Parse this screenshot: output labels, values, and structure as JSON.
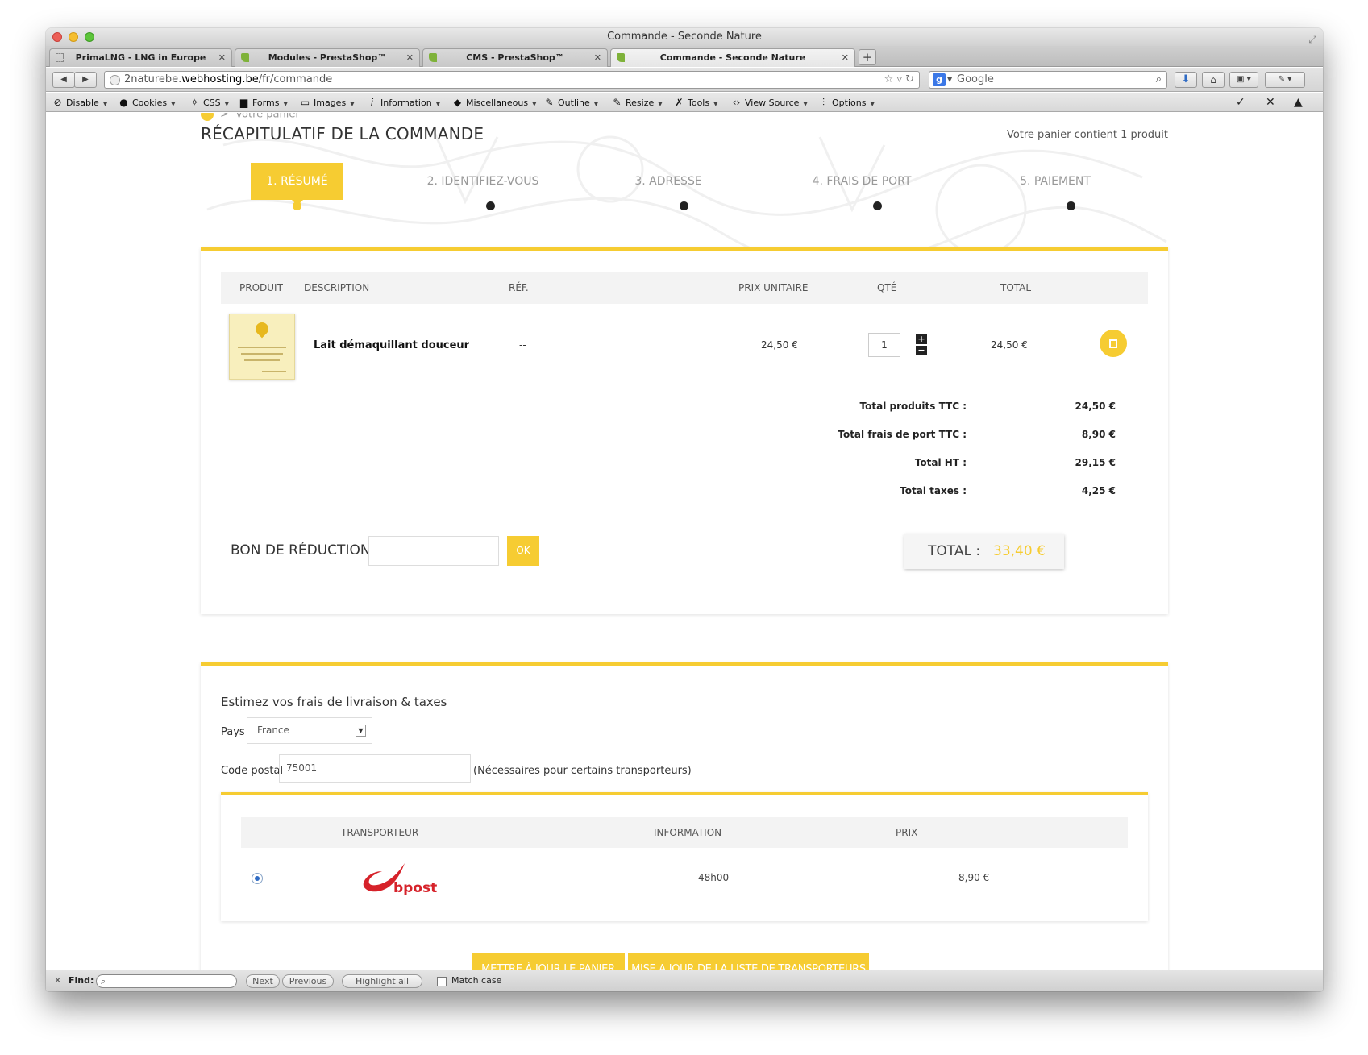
{
  "window": {
    "title": "Commande - Seconde Nature"
  },
  "tabs": [
    {
      "label": "PrimaLNG - LNG in Europe",
      "active": false
    },
    {
      "label": "Modules - PrestaShop™",
      "active": false
    },
    {
      "label": "CMS - PrestaShop™",
      "active": false
    },
    {
      "label": "Commande - Seconde Nature",
      "active": true
    }
  ],
  "nav": {
    "url_prefix": "2naturebe.",
    "url_domain": "webhosting.be",
    "url_path": "/fr/commande",
    "search_placeholder": "Google"
  },
  "devbar": {
    "items": [
      "Disable",
      "Cookies",
      "CSS",
      "Forms",
      "Images",
      "Information",
      "Miscellaneous",
      "Outline",
      "Resize",
      "Tools",
      "View Source",
      "Options"
    ]
  },
  "page": {
    "breadcrumb": "Votre panier",
    "title": "RÉCAPITULATIF DE LA COMMANDE",
    "cart_count": "Votre panier contient 1 produit"
  },
  "steps": [
    {
      "label": "1. RÉSUMÉ",
      "active": true
    },
    {
      "label": "2. IDENTIFIEZ-VOUS",
      "active": false
    },
    {
      "label": "3. ADRESSE",
      "active": false
    },
    {
      "label": "4. FRAIS DE PORT",
      "active": false
    },
    {
      "label": "5. PAIEMENT",
      "active": false
    }
  ],
  "cart": {
    "headers": {
      "product": "PRODUIT",
      "description": "DESCRIPTION",
      "ref": "RÉF.",
      "unit_price": "PRIX UNITAIRE",
      "qty": "QTÉ",
      "total": "TOTAL"
    },
    "item": {
      "name": "Lait démaquillant douceur",
      "ref": "--",
      "unit_price": "24,50 €",
      "qty": "1",
      "total": "24,50 €"
    },
    "totals": [
      {
        "label": "Total produits TTC :",
        "value": "24,50 €"
      },
      {
        "label": "Total frais de port TTC :",
        "value": "8,90 €"
      },
      {
        "label": "Total HT :",
        "value": "29,15 €"
      },
      {
        "label": "Total taxes :",
        "value": "4,25 €"
      }
    ],
    "voucher_label": "BON DE RÉDUCTION",
    "voucher_button": "OK",
    "grand_total_label": "TOTAL :",
    "grand_total_value": "33,40 €"
  },
  "shipping": {
    "title": "Estimez vos frais de livraison & taxes",
    "country_label": "Pays",
    "country_value": "France",
    "postcode_label": "Code postal",
    "postcode_value": "75001",
    "postcode_note": "(Nécessaires pour certains transporteurs)",
    "headers": {
      "carrier": "TRANSPORTEUR",
      "info": "INFORMATION",
      "price": "PRIX"
    },
    "carrier": {
      "logo_text": "bpost",
      "info": "48h00",
      "price": "8,90 €"
    },
    "update_cart_button": "METTRE À JOUR LE PANIER",
    "update_carriers_button": "MISE A JOUR DE LA LISTE DE TRANSPORTEURS"
  },
  "findbar": {
    "label": "Find:",
    "next": "Next",
    "previous": "Previous",
    "highlight_all": "Highlight all",
    "match_case": "Match case"
  },
  "colors": {
    "accent": "#f6cc32",
    "carrier_red": "#d6222a"
  }
}
